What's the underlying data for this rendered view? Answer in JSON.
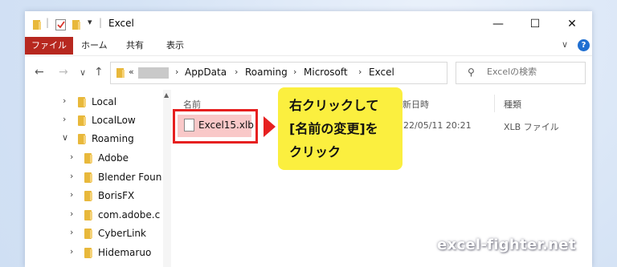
{
  "window": {
    "title": "Excel",
    "controls": {
      "minimize": "—",
      "maximize": "☐",
      "close": "✕"
    }
  },
  "quick_access": {
    "pin": "|",
    "dropdown": "▾"
  },
  "ribbon": {
    "tabs": [
      "ファイル",
      "ホーム",
      "共有",
      "表示"
    ],
    "expand_icon": "∨",
    "help_label": "?"
  },
  "nav_buttons": {
    "back": "←",
    "forward": "→",
    "recent": "∨",
    "up": "↑"
  },
  "address": {
    "prefix": "«",
    "path": [
      "AppData",
      "Roaming",
      "Microsoft",
      "Excel"
    ],
    "separator": "›",
    "dropdown": "∨",
    "refresh": "↻"
  },
  "search": {
    "placeholder": "Excelの検索",
    "icon": "⚲"
  },
  "nav_pane": {
    "items": [
      {
        "label": "Local",
        "chevron": "›"
      },
      {
        "label": "LocalLow",
        "chevron": "›"
      },
      {
        "label": "Roaming",
        "chevron": "∨"
      },
      {
        "label": "Adobe",
        "chevron": "›"
      },
      {
        "label": "Blender Foun",
        "chevron": "›"
      },
      {
        "label": "BorisFX",
        "chevron": "›"
      },
      {
        "label": "com.adobe.c",
        "chevron": "›"
      },
      {
        "label": "CyberLink",
        "chevron": "›"
      },
      {
        "label": "Hidemaruo",
        "chevron": "›"
      }
    ],
    "scroll_up": "▲"
  },
  "columns": {
    "name": "名前",
    "date": "新日時",
    "type": "種類"
  },
  "file": {
    "name": "Excel15.xlb",
    "date": "22/05/11 20:21",
    "type": "XLB ファイル"
  },
  "callout": {
    "line1": "右クリックして",
    "line2": "[名前の変更]を",
    "line3": "クリック"
  },
  "watermark": "excel-fighter.net",
  "colors": {
    "highlight": "#e62020",
    "callout_bg": "#fbef3f",
    "file_tab": "#b7281f",
    "folder": "#e8b83b"
  }
}
